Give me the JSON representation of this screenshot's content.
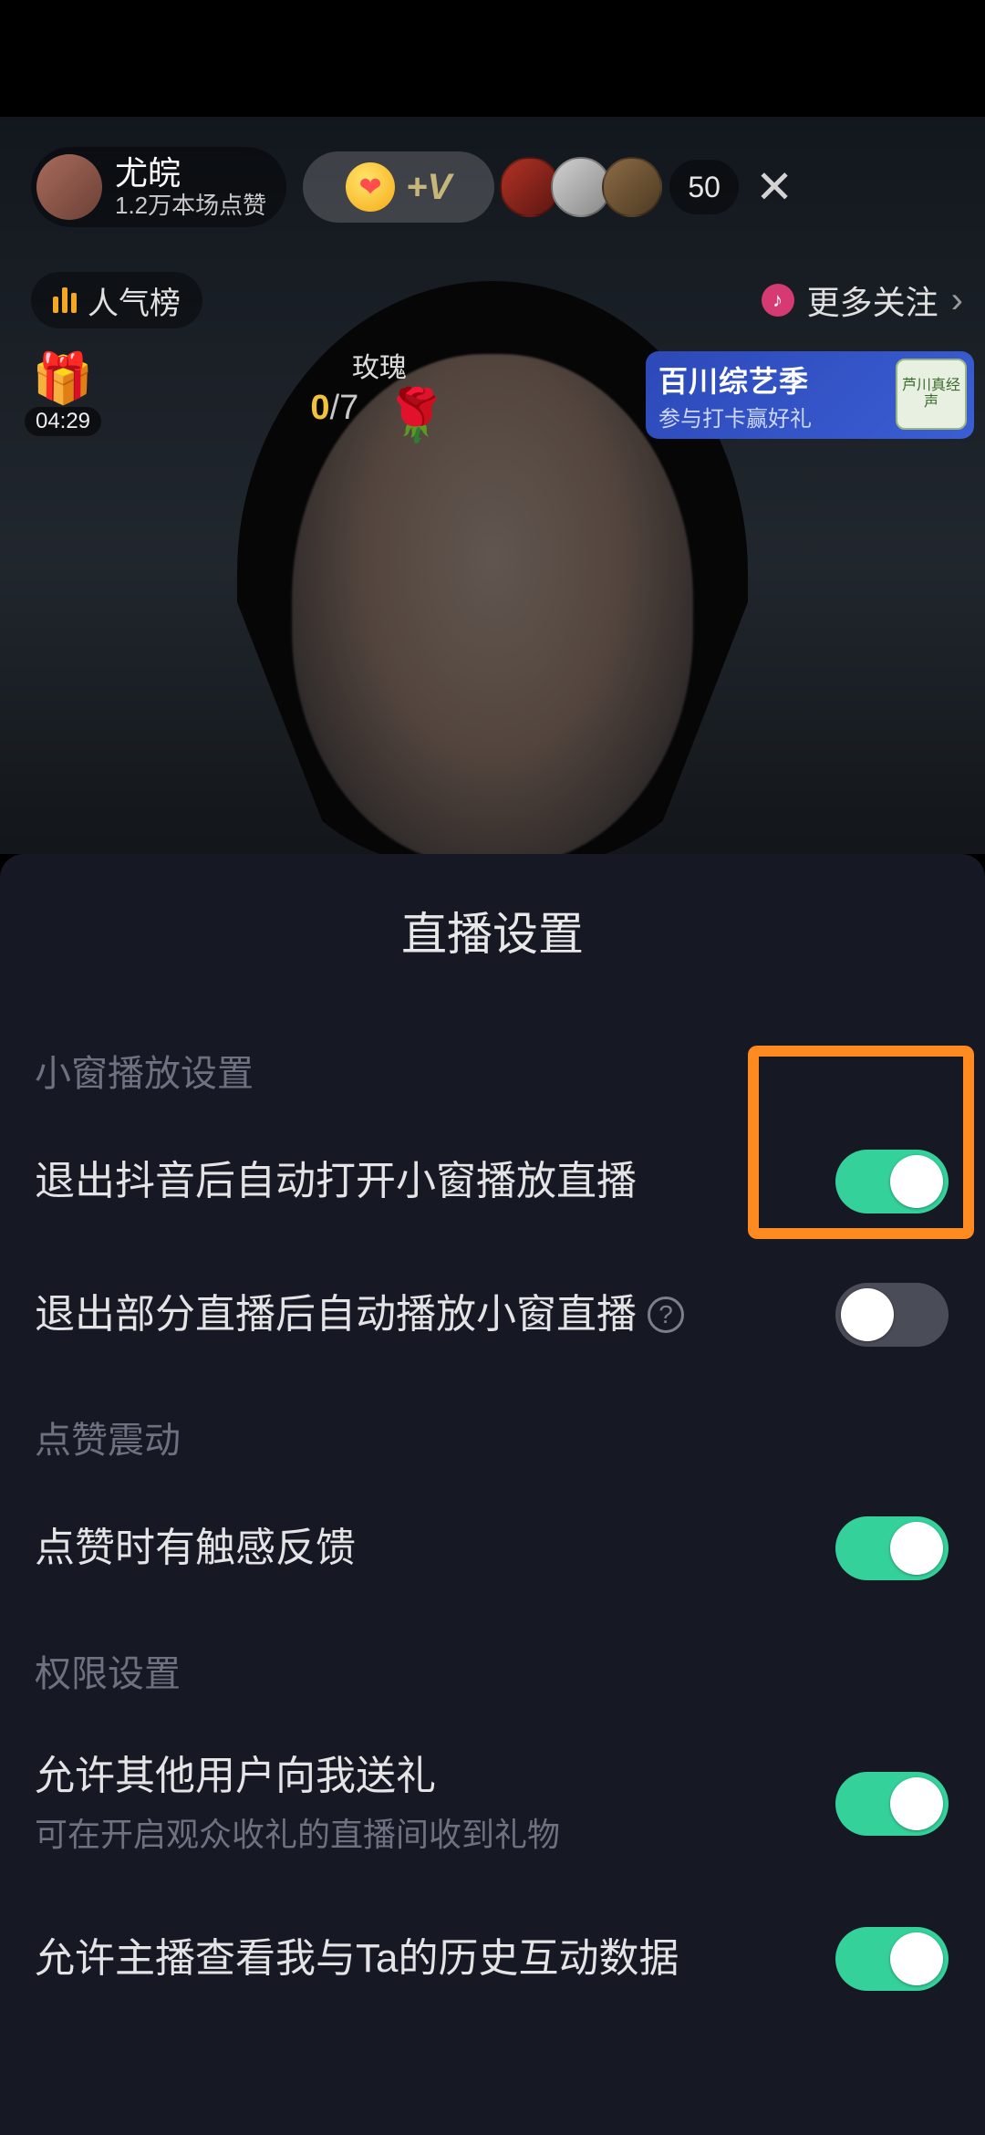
{
  "header": {
    "streamer_name": "尤皖",
    "streamer_subtitle": "1.2万本场点赞",
    "boost_badge": "+V",
    "viewer_count": "50"
  },
  "subheader": {
    "ranking_label": "人气榜",
    "more_follow_label": "更多关注"
  },
  "gift": {
    "countdown": "04:29",
    "rose_label": "玫瑰",
    "rose_current": "0",
    "rose_sep": "/",
    "rose_max": "7"
  },
  "promo": {
    "title": "百川综艺季",
    "subtitle": "参与打卡赢好礼",
    "tag": "芦川真经声"
  },
  "sheet": {
    "title": "直播设置",
    "sections": {
      "mini_window": {
        "label": "小窗播放设置",
        "items": [
          {
            "title": "退出抖音后自动打开小窗播放直播",
            "on": true
          },
          {
            "title": "退出部分直播后自动播放小窗直播",
            "help": true,
            "on": false
          }
        ]
      },
      "like_vibration": {
        "label": "点赞震动",
        "items": [
          {
            "title": "点赞时有触感反馈",
            "on": true
          }
        ]
      },
      "permissions": {
        "label": "权限设置",
        "items": [
          {
            "title": "允许其他用户向我送礼",
            "desc": "可在开启观众收礼的直播间收到礼物",
            "on": true
          },
          {
            "title": "允许主播查看我与Ta的历史互动数据",
            "on": true
          }
        ]
      }
    }
  },
  "highlight": {
    "present": true
  }
}
